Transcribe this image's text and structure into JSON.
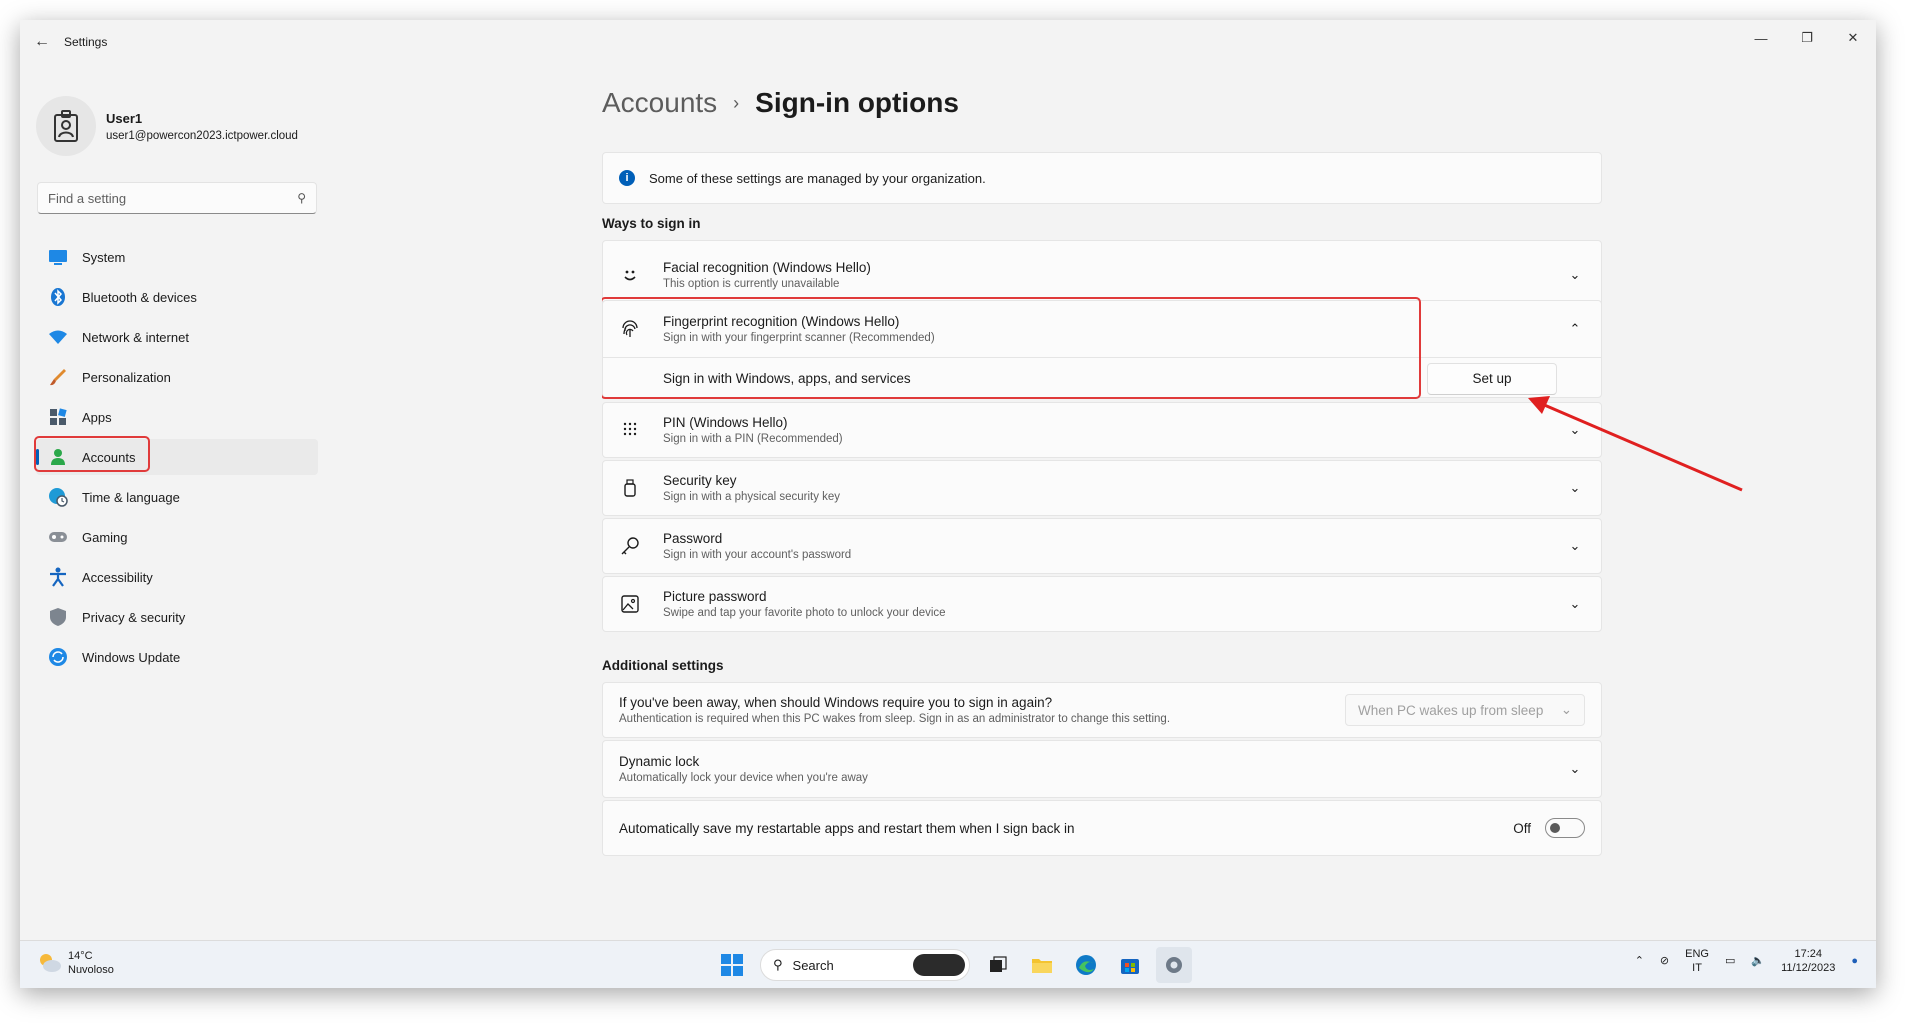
{
  "window": {
    "title": "Settings",
    "back_icon": "back-arrow-icon",
    "controls": [
      "minimize",
      "restore",
      "close"
    ]
  },
  "profile": {
    "name": "User1",
    "email": "user1@powercon2023.ictpower.cloud"
  },
  "search": {
    "placeholder": "Find a setting"
  },
  "sidebar": {
    "items": [
      {
        "label": "System",
        "icon": "system-icon"
      },
      {
        "label": "Bluetooth & devices",
        "icon": "bluetooth-icon"
      },
      {
        "label": "Network & internet",
        "icon": "wifi-icon"
      },
      {
        "label": "Personalization",
        "icon": "brush-icon"
      },
      {
        "label": "Apps",
        "icon": "apps-icon"
      },
      {
        "label": "Accounts",
        "icon": "person-icon",
        "selected": true
      },
      {
        "label": "Time & language",
        "icon": "globe-clock-icon"
      },
      {
        "label": "Gaming",
        "icon": "gamepad-icon"
      },
      {
        "label": "Accessibility",
        "icon": "accessibility-icon"
      },
      {
        "label": "Privacy & security",
        "icon": "shield-icon"
      },
      {
        "label": "Windows Update",
        "icon": "update-icon"
      }
    ]
  },
  "breadcrumb": {
    "parent": "Accounts",
    "separator": "›",
    "current": "Sign-in options"
  },
  "info": {
    "text": "Some of these settings are managed by your organization."
  },
  "ways": {
    "title": "Ways to sign in",
    "items": [
      {
        "title": "Facial recognition (Windows Hello)",
        "sub": "This option is currently unavailable",
        "icon": "face-icon"
      },
      {
        "title": "Fingerprint recognition (Windows Hello)",
        "sub": "Sign in with your fingerprint scanner (Recommended)",
        "icon": "fingerprint-icon",
        "expanded": true,
        "sub_row": {
          "label": "Sign in with Windows, apps, and services",
          "button": "Set up"
        }
      },
      {
        "title": "PIN (Windows Hello)",
        "sub": "Sign in with a PIN (Recommended)",
        "icon": "pin-keypad-icon"
      },
      {
        "title": "Security key",
        "sub": "Sign in with a physical security key",
        "icon": "usb-key-icon"
      },
      {
        "title": "Password",
        "sub": "Sign in with your account's password",
        "icon": "key-icon"
      },
      {
        "title": "Picture password",
        "sub": "Swipe and tap your favorite photo to unlock your device",
        "icon": "picture-icon"
      }
    ]
  },
  "additional": {
    "title": "Additional settings",
    "away": {
      "title": "If you've been away, when should Windows require you to sign in again?",
      "sub": "Authentication is required when this PC wakes from sleep. Sign in as an administrator to change this setting.",
      "dropdown": "When PC wakes up from sleep"
    },
    "dynamic_lock": {
      "title": "Dynamic lock",
      "sub": "Automatically lock your device when you're away"
    },
    "restart_apps": {
      "title": "Automatically save my restartable apps and restart them when I sign back in",
      "state": "Off"
    }
  },
  "taskbar": {
    "weather_temp": "14°C",
    "weather_desc": "Nuvoloso",
    "search": "Search",
    "lang_top": "ENG",
    "lang_bottom": "IT",
    "time": "17:24",
    "date": "11/12/2023"
  },
  "colors": {
    "accent": "#005fb8",
    "highlight": "#e03a3a"
  }
}
